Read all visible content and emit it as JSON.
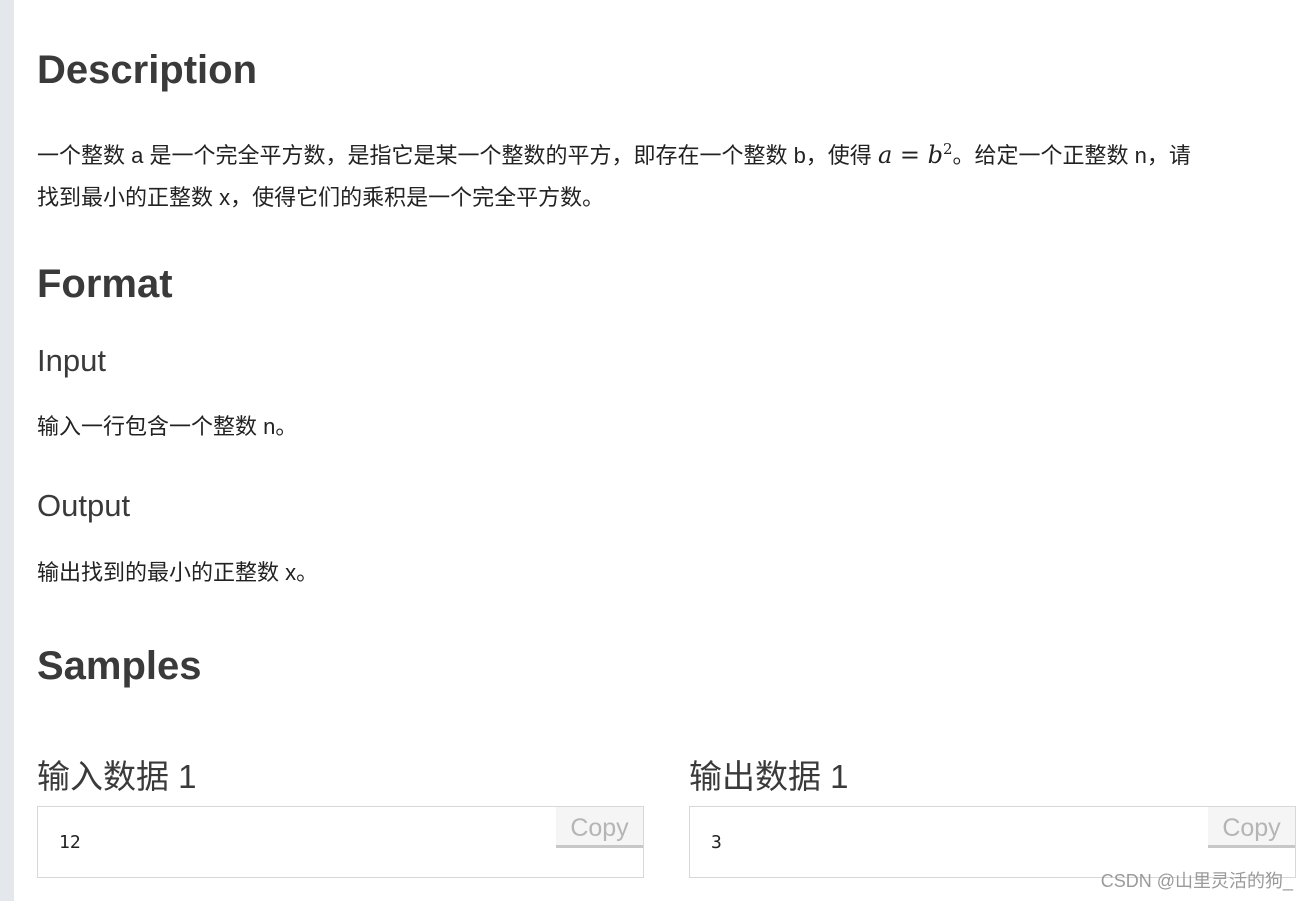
{
  "description": {
    "heading": "Description",
    "line1_part1": "一个整数 a 是一个完全平方数，是指它是某一个整数的平方，即存在一个整数 b，使得 ",
    "math_base": "a = b",
    "math_exp": "2",
    "line1_part2": "。给定一个正整数 n，请",
    "line2": "找到最小的正整数 x，使得它们的乘积是一个完全平方数。"
  },
  "format": {
    "heading": "Format",
    "input_heading": "Input",
    "input_text": "输入一行包含一个整数 n。",
    "output_heading": "Output",
    "output_text": "输出找到的最小的正整数 x。"
  },
  "samples": {
    "heading": "Samples",
    "input_title": "输入数据 1",
    "input_value": "12",
    "output_title": "输出数据 1",
    "output_value": "3",
    "copy_label": "Copy"
  },
  "watermark": "CSDN @山里灵活的狗_"
}
